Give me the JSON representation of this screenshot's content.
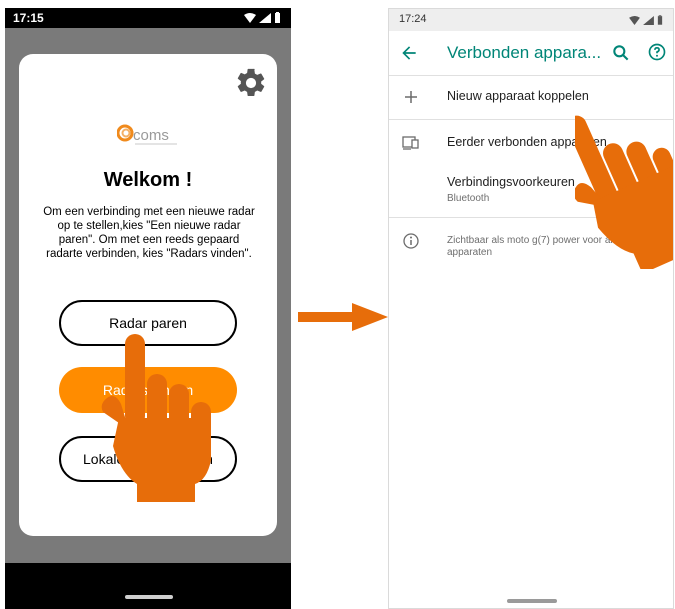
{
  "left_screen": {
    "status_time": "17:15",
    "welcome_title": "Welkom !",
    "intro_text": "Om een verbinding met een nieuwe radar op te stellen,kies \"Een nieuwe radar paren\". Om met een reeds gepaard radarte verbinden, kies \"Radars vinden\".",
    "buttons": {
      "pair": "Radar paren",
      "find": "Radars vinden",
      "local": "Lokale radars vinden"
    },
    "colors": {
      "accent": "#ff8c00",
      "overlay": "#7a7a7a"
    }
  },
  "right_screen": {
    "status_time": "17:24",
    "title": "Verbonden appara...",
    "items": [
      {
        "icon": "plus-icon",
        "label": "Nieuw apparaat koppelen"
      },
      {
        "icon": "devices-icon",
        "label": "Eerder verbonden apparaten"
      },
      {
        "icon": "",
        "label": "Verbindingsvoorkeuren",
        "sublabel": "Bluetooth"
      }
    ],
    "info_text": "Zichtbaar als moto g(7) power voor andere apparaten",
    "colors": {
      "accent": "#008577"
    }
  },
  "annotations": {
    "tap_color": "#e76d0a"
  }
}
